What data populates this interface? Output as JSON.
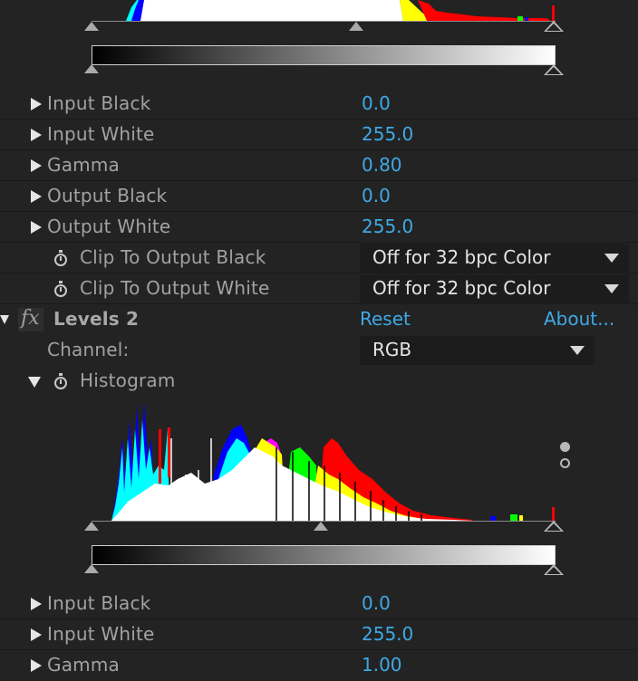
{
  "effect1": {
    "params": [
      {
        "label": "Input Black",
        "value": "0.0"
      },
      {
        "label": "Input White",
        "value": "255.0"
      },
      {
        "label": "Gamma",
        "value": "0.80"
      },
      {
        "label": "Output Black",
        "value": "0.0"
      },
      {
        "label": "Output White",
        "value": "255.0"
      }
    ],
    "clip_black": {
      "label": "Clip To Output Black",
      "value": "Off for 32 bpc Color"
    },
    "clip_white": {
      "label": "Clip To Output White",
      "value": "Off for 32 bpc Color"
    }
  },
  "effect2": {
    "fx_symbol": "fx",
    "name": "Levels 2",
    "reset": "Reset",
    "about": "About...",
    "channel_label": "Channel:",
    "channel_value": "RGB",
    "histogram_label": "Histogram",
    "params": [
      {
        "label": "Input Black",
        "value": "0.0"
      },
      {
        "label": "Input White",
        "value": "255.0"
      },
      {
        "label": "Gamma",
        "value": "1.00"
      }
    ]
  },
  "colors": {
    "accent": "#3ea9e6",
    "panel": "#232323",
    "red": "#ff0000",
    "green": "#00ff00",
    "blue": "#0000ff",
    "cyan": "#00ffff",
    "yellow": "#ffff00",
    "magenta": "#ff00ff"
  }
}
